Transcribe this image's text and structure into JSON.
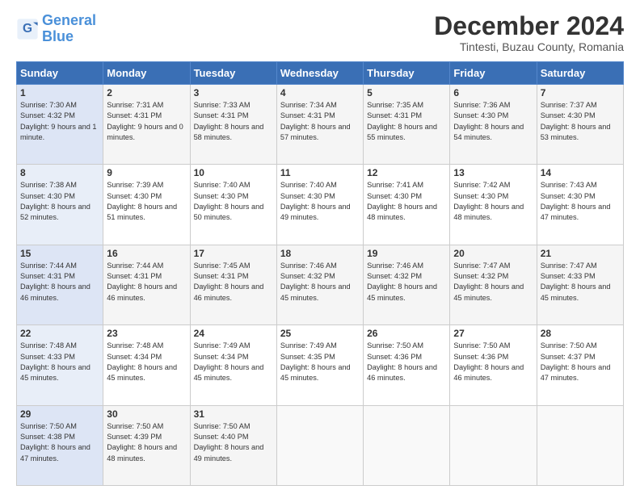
{
  "logo": {
    "line1": "General",
    "line2": "Blue"
  },
  "title": "December 2024",
  "subtitle": "Tintesti, Buzau County, Romania",
  "days_of_week": [
    "Sunday",
    "Monday",
    "Tuesday",
    "Wednesday",
    "Thursday",
    "Friday",
    "Saturday"
  ],
  "weeks": [
    [
      {
        "day": 1,
        "sunrise": "7:30 AM",
        "sunset": "4:32 PM",
        "daylight": "9 hours and 1 minute."
      },
      {
        "day": 2,
        "sunrise": "7:31 AM",
        "sunset": "4:31 PM",
        "daylight": "9 hours and 0 minutes."
      },
      {
        "day": 3,
        "sunrise": "7:33 AM",
        "sunset": "4:31 PM",
        "daylight": "8 hours and 58 minutes."
      },
      {
        "day": 4,
        "sunrise": "7:34 AM",
        "sunset": "4:31 PM",
        "daylight": "8 hours and 57 minutes."
      },
      {
        "day": 5,
        "sunrise": "7:35 AM",
        "sunset": "4:31 PM",
        "daylight": "8 hours and 55 minutes."
      },
      {
        "day": 6,
        "sunrise": "7:36 AM",
        "sunset": "4:30 PM",
        "daylight": "8 hours and 54 minutes."
      },
      {
        "day": 7,
        "sunrise": "7:37 AM",
        "sunset": "4:30 PM",
        "daylight": "8 hours and 53 minutes."
      }
    ],
    [
      {
        "day": 8,
        "sunrise": "7:38 AM",
        "sunset": "4:30 PM",
        "daylight": "8 hours and 52 minutes."
      },
      {
        "day": 9,
        "sunrise": "7:39 AM",
        "sunset": "4:30 PM",
        "daylight": "8 hours and 51 minutes."
      },
      {
        "day": 10,
        "sunrise": "7:40 AM",
        "sunset": "4:30 PM",
        "daylight": "8 hours and 50 minutes."
      },
      {
        "day": 11,
        "sunrise": "7:40 AM",
        "sunset": "4:30 PM",
        "daylight": "8 hours and 49 minutes."
      },
      {
        "day": 12,
        "sunrise": "7:41 AM",
        "sunset": "4:30 PM",
        "daylight": "8 hours and 48 minutes."
      },
      {
        "day": 13,
        "sunrise": "7:42 AM",
        "sunset": "4:30 PM",
        "daylight": "8 hours and 48 minutes."
      },
      {
        "day": 14,
        "sunrise": "7:43 AM",
        "sunset": "4:30 PM",
        "daylight": "8 hours and 47 minutes."
      }
    ],
    [
      {
        "day": 15,
        "sunrise": "7:44 AM",
        "sunset": "4:31 PM",
        "daylight": "8 hours and 46 minutes."
      },
      {
        "day": 16,
        "sunrise": "7:44 AM",
        "sunset": "4:31 PM",
        "daylight": "8 hours and 46 minutes."
      },
      {
        "day": 17,
        "sunrise": "7:45 AM",
        "sunset": "4:31 PM",
        "daylight": "8 hours and 46 minutes."
      },
      {
        "day": 18,
        "sunrise": "7:46 AM",
        "sunset": "4:32 PM",
        "daylight": "8 hours and 45 minutes."
      },
      {
        "day": 19,
        "sunrise": "7:46 AM",
        "sunset": "4:32 PM",
        "daylight": "8 hours and 45 minutes."
      },
      {
        "day": 20,
        "sunrise": "7:47 AM",
        "sunset": "4:32 PM",
        "daylight": "8 hours and 45 minutes."
      },
      {
        "day": 21,
        "sunrise": "7:47 AM",
        "sunset": "4:33 PM",
        "daylight": "8 hours and 45 minutes."
      }
    ],
    [
      {
        "day": 22,
        "sunrise": "7:48 AM",
        "sunset": "4:33 PM",
        "daylight": "8 hours and 45 minutes."
      },
      {
        "day": 23,
        "sunrise": "7:48 AM",
        "sunset": "4:34 PM",
        "daylight": "8 hours and 45 minutes."
      },
      {
        "day": 24,
        "sunrise": "7:49 AM",
        "sunset": "4:34 PM",
        "daylight": "8 hours and 45 minutes."
      },
      {
        "day": 25,
        "sunrise": "7:49 AM",
        "sunset": "4:35 PM",
        "daylight": "8 hours and 45 minutes."
      },
      {
        "day": 26,
        "sunrise": "7:50 AM",
        "sunset": "4:36 PM",
        "daylight": "8 hours and 46 minutes."
      },
      {
        "day": 27,
        "sunrise": "7:50 AM",
        "sunset": "4:36 PM",
        "daylight": "8 hours and 46 minutes."
      },
      {
        "day": 28,
        "sunrise": "7:50 AM",
        "sunset": "4:37 PM",
        "daylight": "8 hours and 47 minutes."
      }
    ],
    [
      {
        "day": 29,
        "sunrise": "7:50 AM",
        "sunset": "4:38 PM",
        "daylight": "8 hours and 47 minutes."
      },
      {
        "day": 30,
        "sunrise": "7:50 AM",
        "sunset": "4:39 PM",
        "daylight": "8 hours and 48 minutes."
      },
      {
        "day": 31,
        "sunrise": "7:50 AM",
        "sunset": "4:40 PM",
        "daylight": "8 hours and 49 minutes."
      },
      null,
      null,
      null,
      null
    ]
  ]
}
